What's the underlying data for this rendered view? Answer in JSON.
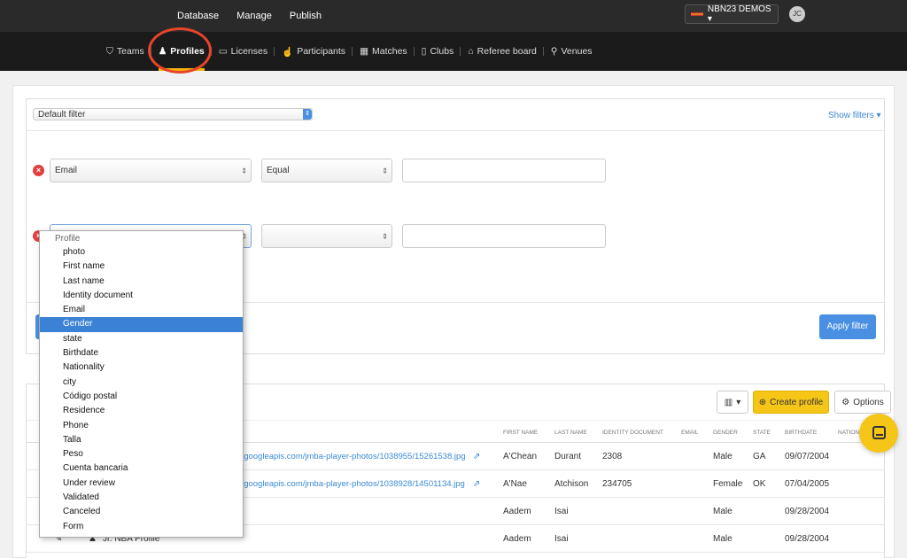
{
  "topnav": {
    "items": [
      "Database",
      "Manage",
      "Publish"
    ]
  },
  "org_switcher": {
    "label": "NBN23 DEMOS ▾"
  },
  "user": {
    "initials": "JC"
  },
  "subnav": {
    "tabs": [
      {
        "label": "Teams",
        "icon": "shield-icon"
      },
      {
        "label": "Profiles",
        "icon": "user-icon"
      },
      {
        "label": "Licenses",
        "icon": "card-icon"
      },
      {
        "label": "Participants",
        "icon": "thumb-icon"
      },
      {
        "label": "Matches",
        "icon": "calendar-icon"
      },
      {
        "label": "Clubs",
        "icon": "building-icon"
      },
      {
        "label": "Referee board",
        "icon": "bank-icon"
      },
      {
        "label": "Venues",
        "icon": "pin-icon"
      }
    ]
  },
  "filter": {
    "default_filter": "Default filter",
    "show_filters": "Show filters ▾",
    "row1_field": "Email",
    "row1_op": "Equal",
    "apply_label": "Apply filter"
  },
  "dropdown": {
    "group": "Profile",
    "options": [
      "photo",
      "First name",
      "Last name",
      "Identity document",
      "Email",
      "Gender",
      "state",
      "Birthdate",
      "Nationality",
      "city",
      "Código postal",
      "Residence",
      "Phone",
      "Talla",
      "Peso",
      "Cuenta bancaria",
      "Under review",
      "Validated",
      "Canceled",
      "Form"
    ],
    "selected": "Gender"
  },
  "toolbar": {
    "columns_label": "▾",
    "create_label": "Create profile",
    "options_label": "Options"
  },
  "table": {
    "headers": [
      "FIRST NAME",
      "LAST NAME",
      "IDENTITY DOCUMENT",
      "EMAIL",
      "GENDER",
      "STATE",
      "BIRTHDATE",
      "NATION"
    ],
    "rows": [
      {
        "photo": "ge.googleapis.com/jmba-player-photos/1038955/15261538.jpg",
        "first": "A'Chean",
        "last": "Durant",
        "id": "2308",
        "gender": "Male",
        "state": "GA",
        "birth": "09/07/2004"
      },
      {
        "photo": "ge.googleapis.com/jmba-player-photos/1038928/14501134.jpg",
        "first": "A'Nae",
        "last": "Atchison",
        "id": "234705",
        "gender": "Female",
        "state": "OK",
        "birth": "07/04/2005"
      },
      {
        "photo": "",
        "first": "Aadem",
        "last": "Isai",
        "id": "",
        "gender": "Male",
        "state": "",
        "birth": "09/28/2004"
      },
      {
        "photo": "Jr. NBA Profile",
        "first": "Aadem",
        "last": "Isai",
        "id": "",
        "gender": "Male",
        "state": "",
        "birth": "09/28/2004"
      }
    ]
  }
}
